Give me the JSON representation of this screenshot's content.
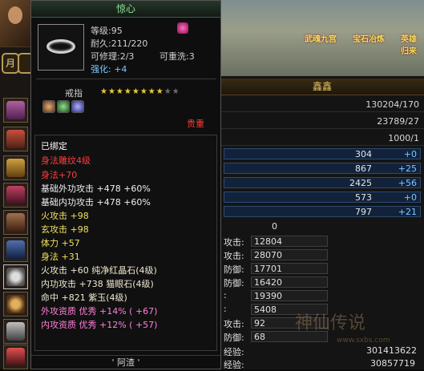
{
  "tooltip": {
    "title": "惊心",
    "level": "等级:95",
    "durability": "耐久:211/220",
    "repairable": "可修理:2/3",
    "rewash": "可重洗:3",
    "enhance": "强化: +4",
    "item_type": "戒指",
    "stars_on": "★★★★★★★★",
    "stars_off": "★★",
    "rarity": "贵重",
    "bound": "已绑定",
    "engrave": "身法雕纹4级",
    "engrave_bonus": "身法+70",
    "attrs": [
      {
        "text": "基础外功攻击 +478 +60%",
        "color": "#9ad8ff"
      },
      {
        "text": "基础内功攻击 +478 +60%",
        "color": "#9ad8ff"
      },
      {
        "text": "火攻击 +98",
        "color": "#f0e060"
      },
      {
        "text": "玄攻击 +98",
        "color": "#f0e060"
      },
      {
        "text": "体力 +57",
        "color": "#f0e060"
      },
      {
        "text": "身法 +31",
        "color": "#f0e060"
      },
      {
        "text": "火攻击 +60 纯净红晶石(4级)",
        "color": "#f0e8d0"
      },
      {
        "text": "内功攻击 +738 猫眼石(4级)",
        "color": "#f0e8d0"
      },
      {
        "text": "命中 +821 紫玉(4级)",
        "color": "#f0e8d0"
      },
      {
        "text": "外攻资质  优秀 +14% ( +67)",
        "color": "#ff80d8"
      },
      {
        "text": "内攻资质  优秀 +12% ( +57)",
        "color": "#ff80d8"
      }
    ],
    "footer": "' 阿渣 '"
  },
  "panel": {
    "title": "鑫鑫",
    "rows": [
      "130204/170",
      "23789/27",
      "1000/1"
    ],
    "bars": [
      {
        "n": "304",
        "p": "+0"
      },
      {
        "n": "867",
        "p": "+25"
      },
      {
        "n": "2425",
        "p": "+56"
      },
      {
        "n": "573",
        "p": "+0"
      },
      {
        "n": "797",
        "p": "+21"
      }
    ],
    "zero": "0",
    "fields": [
      {
        "label": "攻击:",
        "value": "12804"
      },
      {
        "label": "攻击:",
        "value": "28070"
      },
      {
        "label": "防御:",
        "value": "17701"
      },
      {
        "label": "防御:",
        "value": "16420"
      },
      {
        "label": ":",
        "value": "19390"
      },
      {
        "label": ":",
        "value": "5408"
      },
      {
        "label": "攻击:",
        "value": "92"
      },
      {
        "label": "防御:",
        "value": "68"
      }
    ],
    "exp_label_1": "经验:",
    "exp_value_1": "301413622",
    "exp_label_2": "经验:",
    "exp_value_2": "30857719"
  },
  "left": {
    "moon": "月"
  },
  "banners": [
    "武魂九宫",
    "宝石冶炼",
    "英雄归来"
  ],
  "watermark": "神仙传说",
  "watermark_url": "www.sxbs.com"
}
